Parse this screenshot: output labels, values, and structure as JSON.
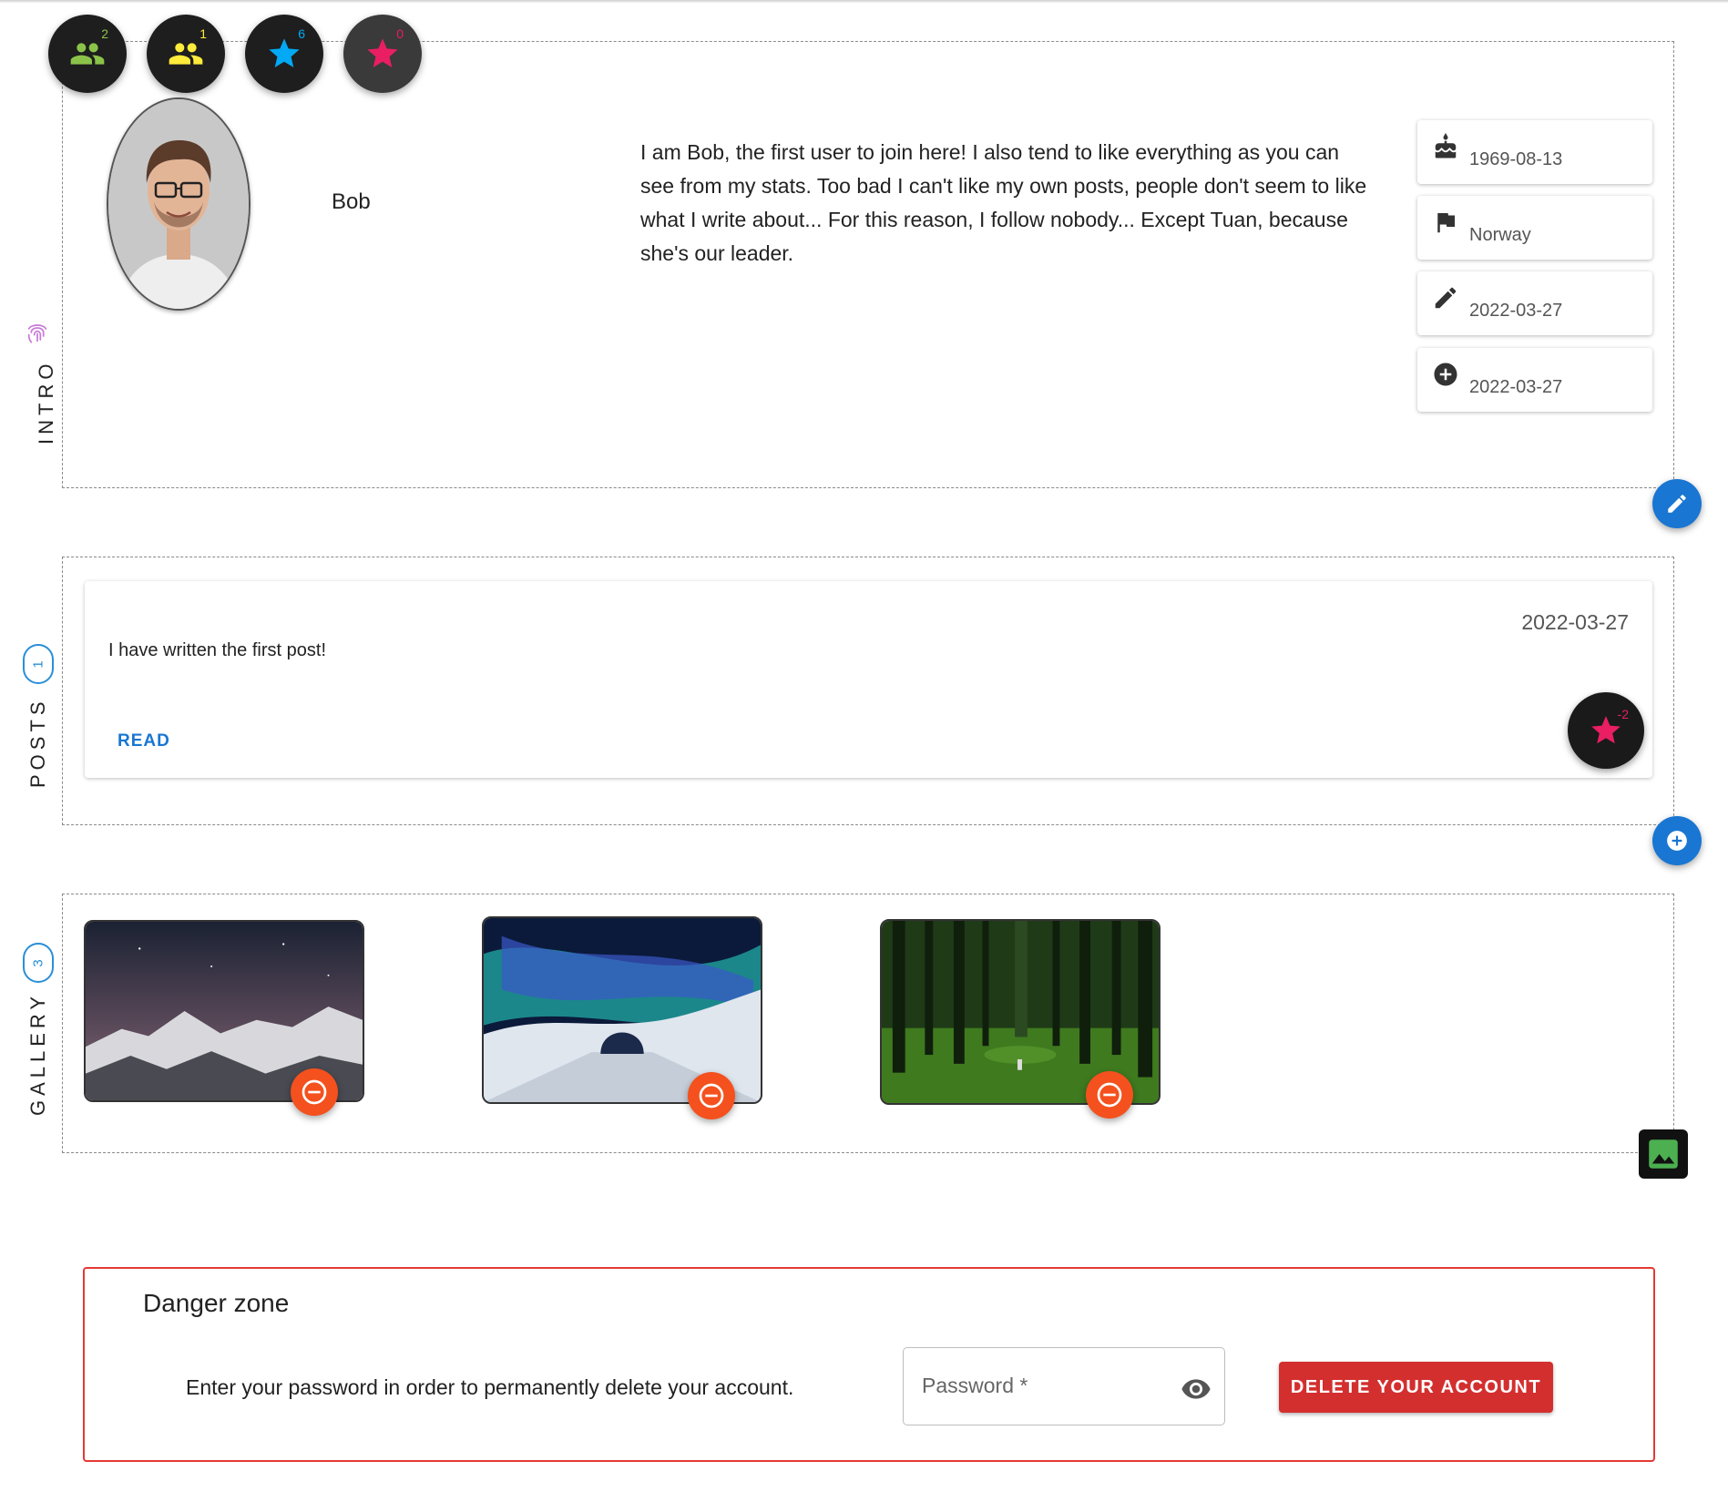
{
  "stats": [
    {
      "name": "followers",
      "count": "2",
      "color": "#8bc34a",
      "icon": "group-icon"
    },
    {
      "name": "following",
      "count": "1",
      "color": "#ffeb3b",
      "icon": "group-icon"
    },
    {
      "name": "likes-given",
      "count": "6",
      "color": "#03a9f4",
      "icon": "star-icon"
    },
    {
      "name": "likes-received",
      "count": "0",
      "color": "#e91e63",
      "icon": "star-icon"
    }
  ],
  "intro": {
    "label": "INTRO",
    "username": "Bob",
    "bio": "I am Bob, the first user to join here! I also tend to like everything as you can see from my stats. Too bad I can't like my own posts, people don't seem to like what I write about... For this reason, I follow nobody... Except Tuan, because she's our leader.",
    "birthday": "1969-08-13",
    "country": "Norway",
    "updated": "2022-03-27",
    "created": "2022-03-27"
  },
  "posts": {
    "label": "POSTS",
    "count": "1",
    "items": [
      {
        "date": "2022-03-27",
        "text": "I have written the first post!",
        "read_label": "READ",
        "likes": "-2"
      }
    ]
  },
  "gallery": {
    "label": "GALLERY",
    "count": "3",
    "images": [
      {
        "name": "snowy-mountains-night"
      },
      {
        "name": "aurora-ice-tunnel"
      },
      {
        "name": "green-forest-path"
      }
    ]
  },
  "danger": {
    "title": "Danger zone",
    "description": "Enter your password in order to permanently delete your account.",
    "password_placeholder": "Password *",
    "delete_label": "DELETE YOUR ACCOUNT"
  },
  "colors": {
    "accent": "#1976d2",
    "danger": "#d32f2f",
    "remove": "#f4511e"
  }
}
